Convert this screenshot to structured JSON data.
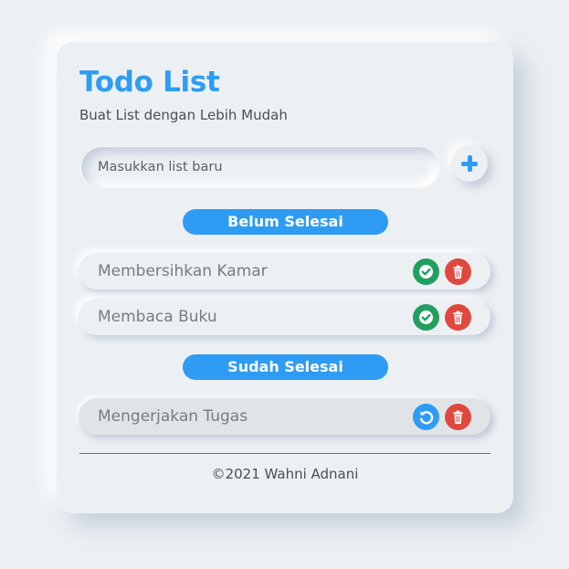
{
  "app": {
    "title": "Todo List",
    "subtitle": "Buat List dengan Lebih Mudah"
  },
  "new_item": {
    "placeholder": "Masukkan list baru",
    "value": "",
    "add_icon": "plus-icon"
  },
  "sections": {
    "pending_label": "Belum Selesai",
    "done_label": "Sudah Selesai"
  },
  "pending_items": [
    {
      "label": "Membersihkan Kamar",
      "actions": [
        "check-circle-icon",
        "trash-icon"
      ]
    },
    {
      "label": "Membaca Buku",
      "actions": [
        "check-circle-icon",
        "trash-icon"
      ]
    }
  ],
  "done_items": [
    {
      "label": "Mengerjakan Tugas",
      "actions": [
        "undo-icon",
        "trash-icon"
      ]
    }
  ],
  "footer": {
    "text": "©2021 Wahni Adnani"
  },
  "colors": {
    "background": "#ecf0f3",
    "accent": "#2f9cf4",
    "check": "#20a060",
    "delete": "#e0483e",
    "undo": "#2f9cf4"
  }
}
